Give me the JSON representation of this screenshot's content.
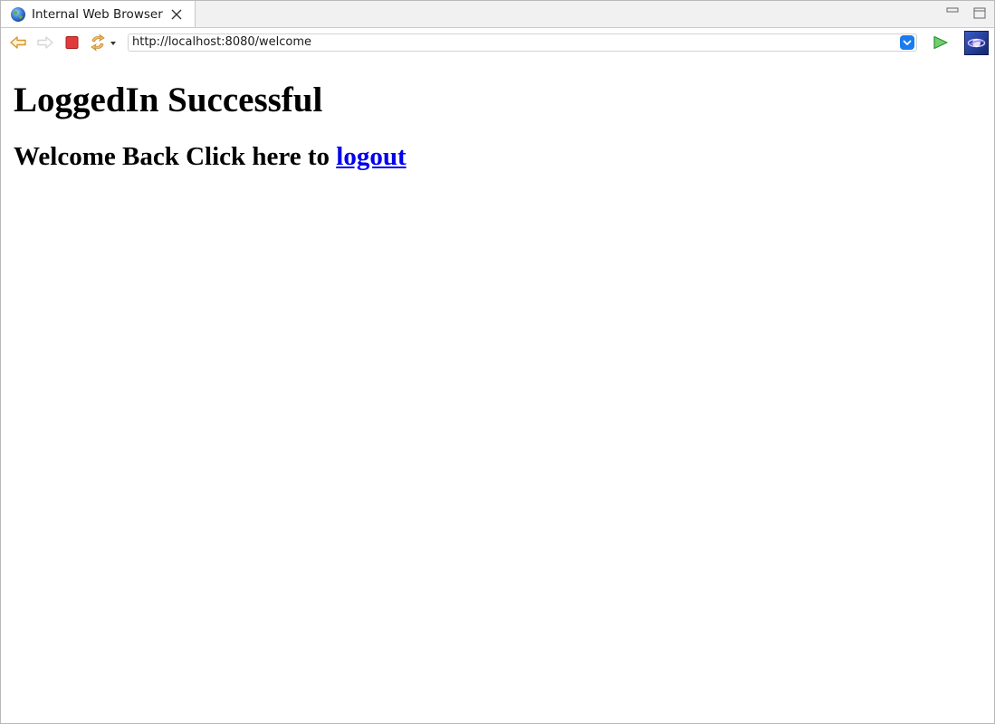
{
  "tab": {
    "label": "Internal Web Browser"
  },
  "toolbar": {
    "url": "http://localhost:8080/welcome"
  },
  "page": {
    "title": "LoggedIn Successful",
    "subtitle_prefix": "Welcome Back Click here to ",
    "logout_link": "logout"
  },
  "icons": {
    "back": "back-arrow-icon",
    "forward": "forward-arrow-icon",
    "stop": "stop-icon",
    "refresh": "refresh-icon",
    "url_dropdown": "chevron-down-icon",
    "go": "go-play-icon",
    "app": "eclipse-icon",
    "minimize": "minimize-icon",
    "maximize": "maximize-icon",
    "tab_close": "close-icon",
    "tab_globe": "globe-icon"
  },
  "colors": {
    "link": "#0000ee",
    "stop": "#e23a3a",
    "nav_arrow": "#e0a03a",
    "go": "#3aa53a",
    "dropdown": "#1a7cf0"
  }
}
